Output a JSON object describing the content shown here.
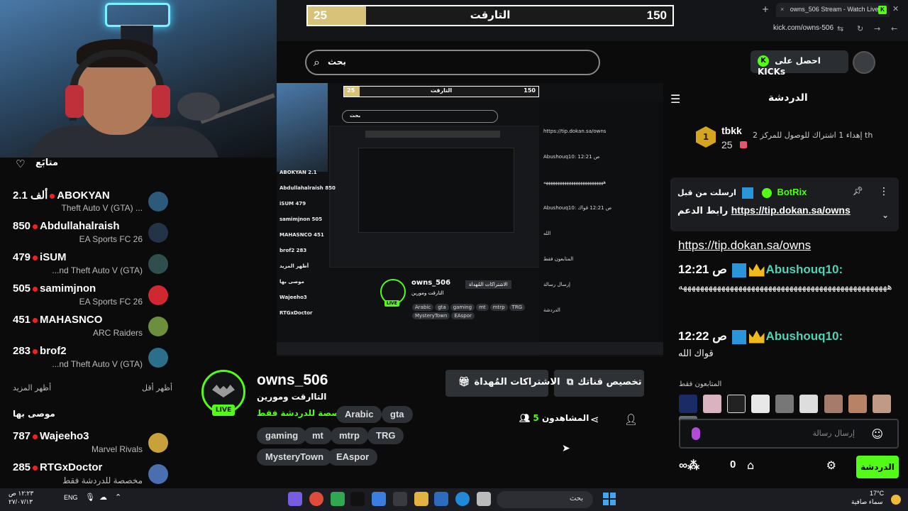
{
  "stream_bar": {
    "left_value": "25",
    "title": "التارقت",
    "right_value": "150",
    "fill_percent": 15.9
  },
  "browser": {
    "tab_title": "owns_506 Stream - Watch Live",
    "tab_close": "×",
    "new_tab": "+",
    "url": "kick.com/owns-506",
    "kick_icon": "K"
  },
  "header": {
    "search_placeholder": "بحث",
    "kicks_button": "احصل على KICKs",
    "kicks_icon": "K"
  },
  "sidebar": {
    "following_title": "متابَع",
    "channels": [
      {
        "viewers": "2.1 ألف",
        "name": "ABOKYAN",
        "game": "Theft Auto V (GTA) ..."
      },
      {
        "viewers": "850",
        "name": "Abdullahalraish",
        "game": "EA Sports FC 26"
      },
      {
        "viewers": "479",
        "name": "iSUM",
        "game": "...nd Theft Auto V (GTA)"
      },
      {
        "viewers": "505",
        "name": "samimjnon",
        "game": "EA Sports FC 26"
      },
      {
        "viewers": "451",
        "name": "MAHASNCO",
        "game": "ARC Raiders"
      },
      {
        "viewers": "283",
        "name": "brof2",
        "game": "...nd Theft Auto V (GTA)"
      }
    ],
    "show_more": "أظهر المزيد",
    "show_less": "أظهر أقل",
    "recommended_title": "موصى بها",
    "recommended": [
      {
        "viewers": "787",
        "name": "Wajeeho3",
        "game": "Marvel Rivals"
      },
      {
        "viewers": "285",
        "name": "RTGxDoctor",
        "game": "مخصصة للدردشة فقط"
      }
    ]
  },
  "nested": {
    "bar_left": "25",
    "bar_title": "التارقت",
    "bar_right": "150",
    "search": "بحث",
    "chat_lines": [
      "https://tip.dokan.sa/owns",
      "Abushouq10: ص 12:21",
      "ههههههههههههههههههههههههههه",
      "Abushouq10: ص 12:21 قواك",
      "الله",
      "المتابعون فقط",
      "إرسال رسالة",
      "الدردشة"
    ],
    "sidebar_lines": [
      "ABOKYAN 2.1",
      "Abdullahalraish 850",
      "iSUM 479",
      "samimjnon 505",
      "MAHASNCO 451",
      "brof2 283",
      "أظهر المزيد",
      "موصى بها",
      "Wajeeho3",
      "RTGxDoctor"
    ],
    "profile_name": "owns_506",
    "profile_title": "التارقت ومورين",
    "profile_tags": [
      "Arabic",
      "gta",
      "gaming",
      "mt",
      "mtrp",
      "TRG",
      "MysteryTown",
      "EAspor"
    ],
    "profile_btn": "الاشتراكات المُهداة",
    "profile_btn2": "تخصيص قناتك",
    "profile_live": "LIVE",
    "viewers": "المشاهدون 5"
  },
  "stream": {
    "name": "owns_506",
    "title": "التاارقت ومورين",
    "category": "مخصصة للدردشة فقط",
    "live": "LIVE",
    "tags": [
      "Arabic",
      "gta",
      "gaming",
      "mt",
      "mtrp",
      "TRG",
      "MysteryTown",
      "EAspor"
    ],
    "gift_subs": "الاشتراكات المُهداة",
    "customize": "تخصيص قناتك",
    "viewers_label": "المشاهدون",
    "viewers_count": "5"
  },
  "chat": {
    "title": "الدردشة",
    "leader": {
      "rank": "1",
      "name": "tbkk",
      "count": "25",
      "subtitle": "إهداء 1 اشتراك للوصول للمركز 2 th"
    },
    "pinned": {
      "header": "ارسلت من قبل",
      "bot": "BotRix",
      "text": "رابط الدعم",
      "link": "https://tip.dokan.sa/owns"
    },
    "link_msg": "https://tip.dokan.sa/owns",
    "messages": [
      {
        "time": "12:21 ص",
        "user": "Abushouq10:",
        "body": "هههههههههههههههههههههههههههههههههههههههههههههههههه"
      },
      {
        "time": "12:22 ص",
        "user": "Abushouq10:",
        "body": "قواك الله"
      }
    ],
    "followers_only": "المتابعون فقط",
    "input_placeholder": "إرسال رسالة",
    "send": "الدردشة",
    "points": "0"
  },
  "taskbar": {
    "time": "١٢:٢٣ ص",
    "date": "٢٧/٠٧/١٣",
    "lang": "ENG",
    "search": "بحث",
    "temp": "17°C",
    "weather": "سماء صافية"
  },
  "colors": {
    "brand": "#53fc18",
    "bg": "#0b0b0c",
    "panel": "#2e3136",
    "bar_fill": "#d7c27a"
  }
}
